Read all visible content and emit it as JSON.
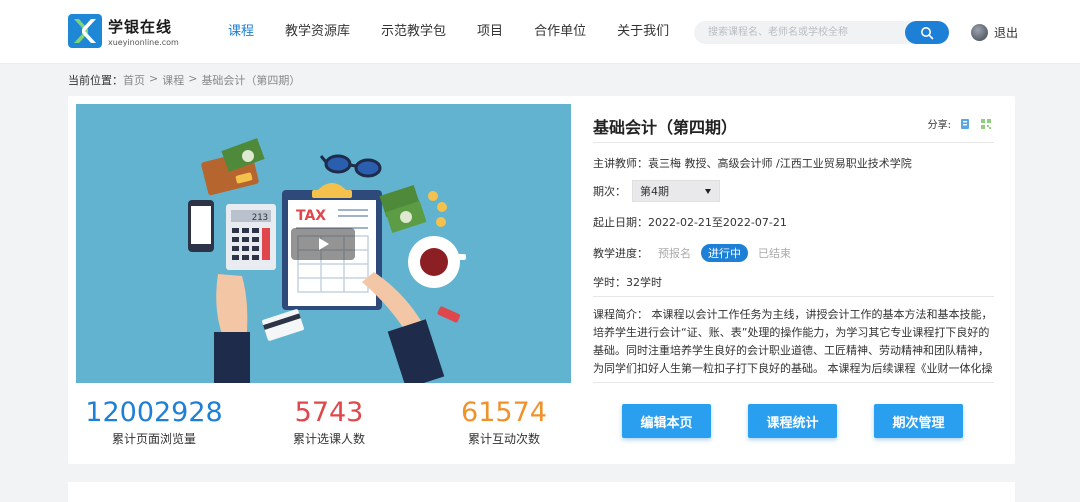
{
  "header": {
    "logo_title": "学银在线",
    "logo_sub": "xueyinonline.com",
    "nav": [
      "课程",
      "教学资源库",
      "示范教学包",
      "项目",
      "合作单位",
      "关于我们"
    ],
    "search_placeholder": "搜索课程名、老师名或学校全称",
    "logout": "退出"
  },
  "breadcrumb": {
    "label": "当前位置：",
    "items": [
      "首页",
      "课程",
      "基础会计（第四期）"
    ],
    "sep": ">"
  },
  "stats": [
    {
      "value": "12002928",
      "label": "累计页面浏览量",
      "color": "#1e7fd6"
    },
    {
      "value": "5743",
      "label": "累计选课人数",
      "color": "#e0474c"
    },
    {
      "value": "61574",
      "label": "累计互动次数",
      "color": "#f0922c"
    }
  ],
  "course": {
    "title": "基础会计（第四期）",
    "share_label": "分享:",
    "teacher": "主讲教师：袁三梅 教授、高级会计师 /江西工业贸易职业技术学院",
    "term_label": "期次：",
    "term_value": "第4期",
    "dates": "起止日期：2022-02-21至2022-07-21",
    "progress_label": "教学进度：",
    "progress_items": [
      "预报名",
      "进行中",
      "已结束"
    ],
    "hours": "学时：32学时",
    "intro": "课程简介： 本课程以会计工作任务为主线，讲授会计工作的基本方法和基本技能，培养学生进行会计“证、账、表”处理的操作能力，为学习其它专业课程打下良好的基础。同时注重培养学生良好的会计职业道德、工匠精神、劳动精神和团队精神，为同学们扣好人生第一粒扣子打下良好的基础。 本课程为后续课程《业财一体化操作》《中级财…"
  },
  "buttons": {
    "edit": "编辑本页",
    "stats": "课程统计",
    "terms": "期次管理"
  },
  "cover_image": {
    "tax_text": "TAX",
    "calc_display": "213"
  },
  "colors": {
    "primary": "#1e7fd6",
    "button": "#2a9ff0",
    "views": "#1e7fd6",
    "students": "#e0474c",
    "interactions": "#f0922c"
  }
}
